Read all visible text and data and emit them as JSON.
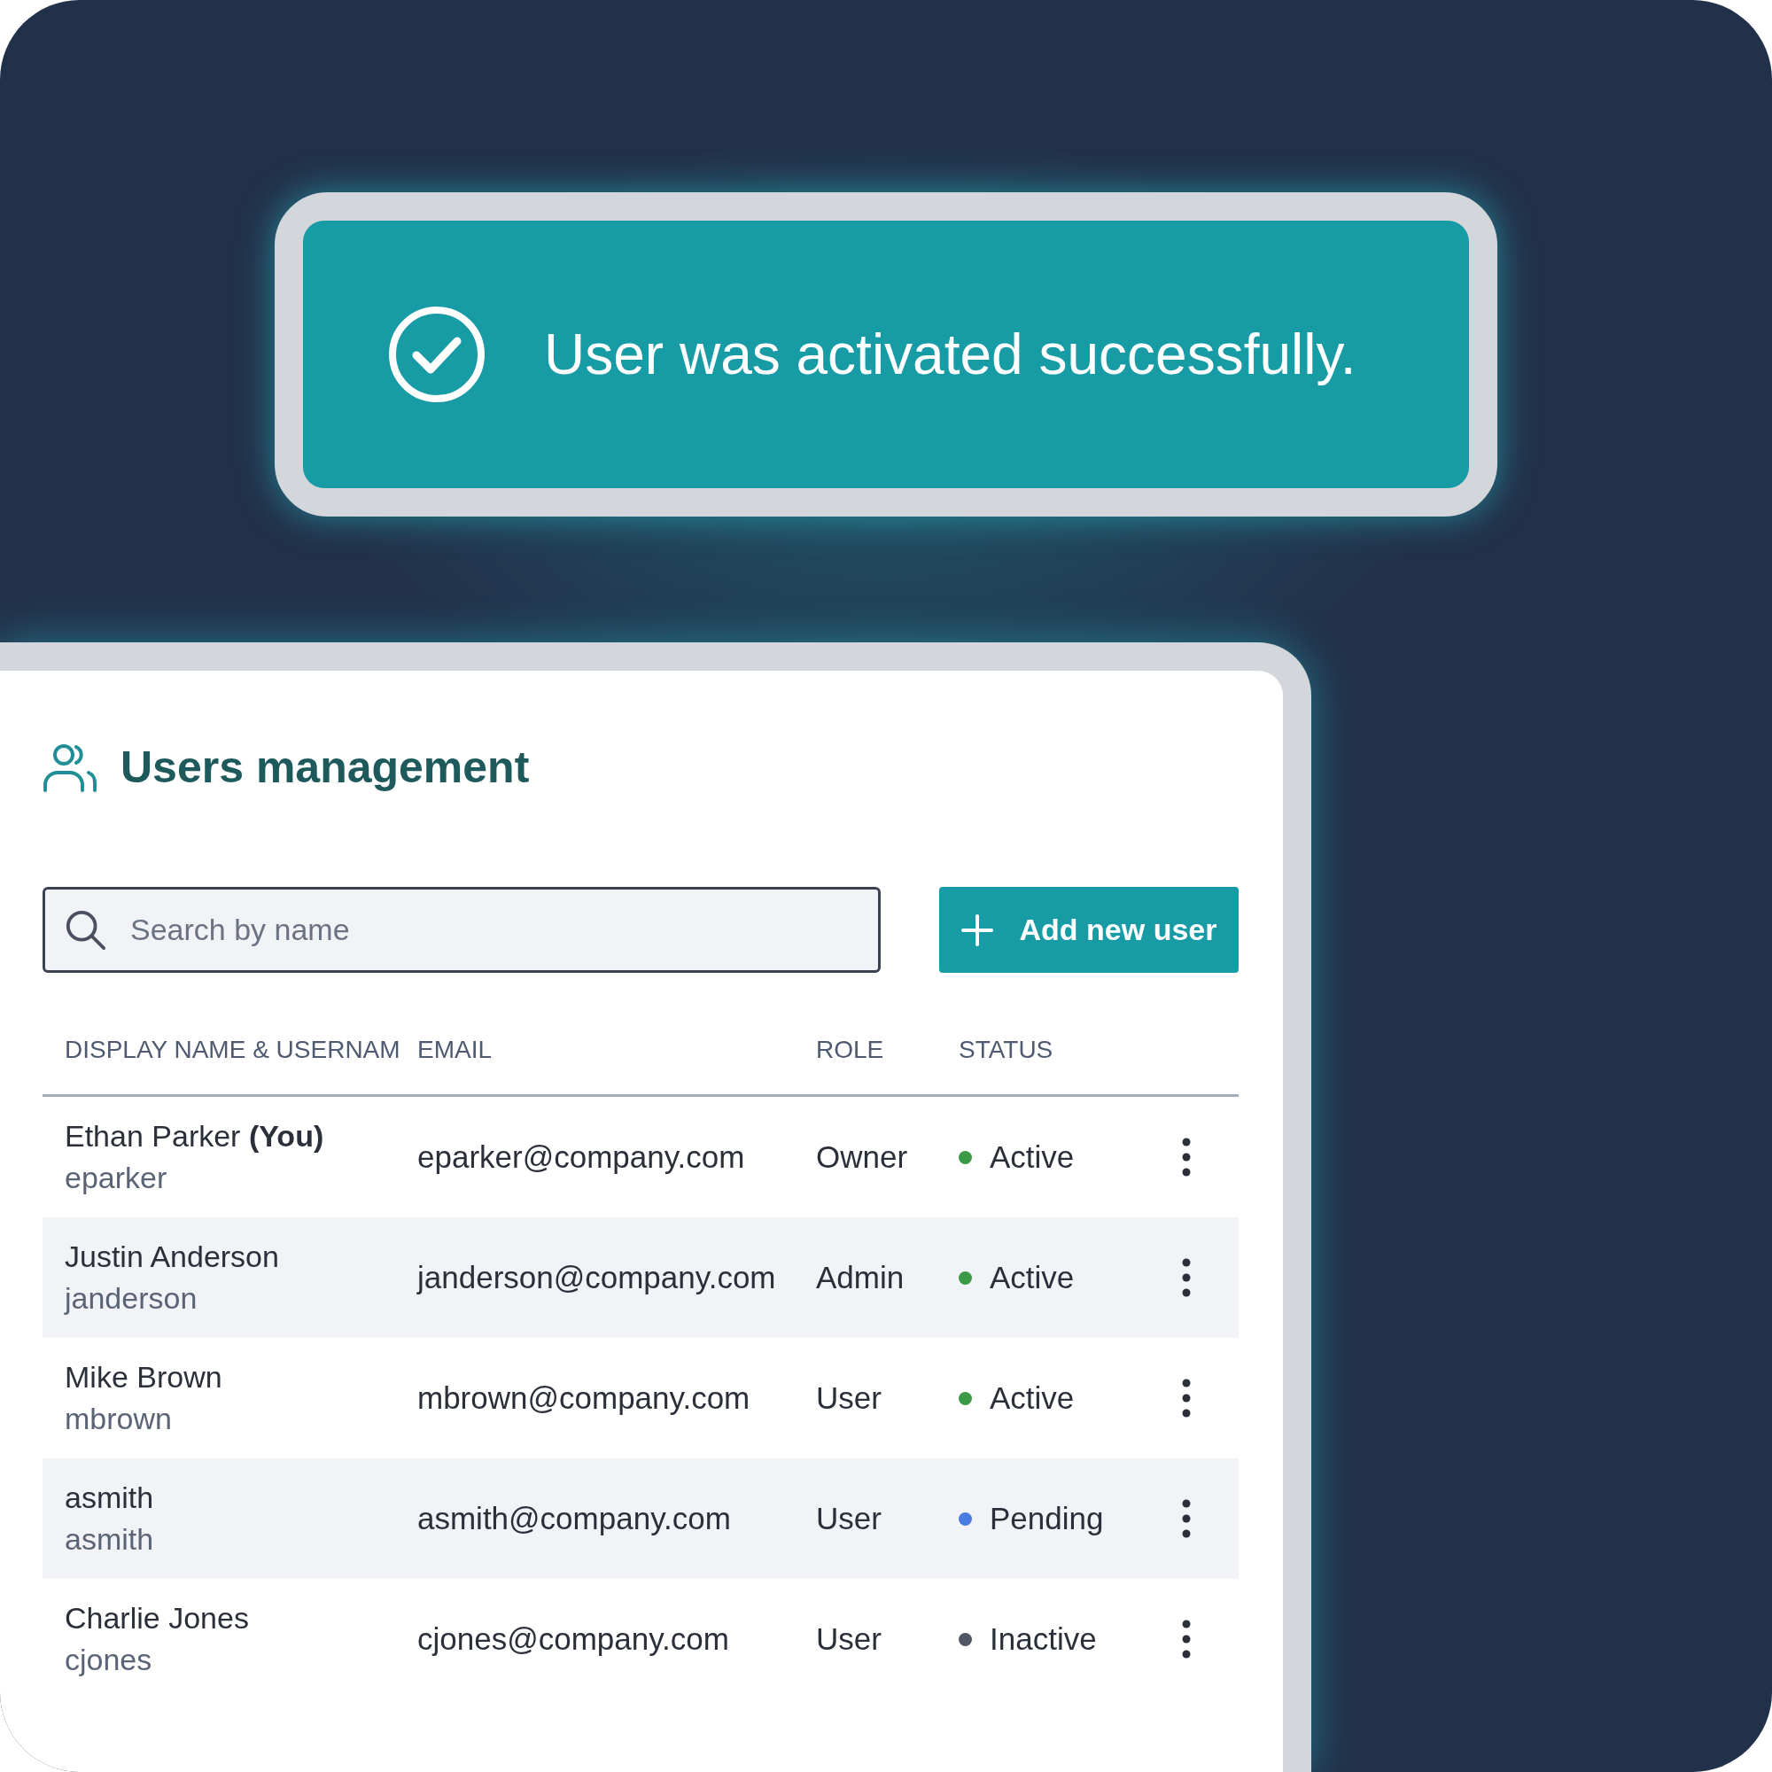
{
  "toast": {
    "message": "User was activated successfully."
  },
  "panel": {
    "title": "Users management",
    "search": {
      "placeholder": "Search by name"
    },
    "add_button": {
      "label": "Add new user"
    },
    "table": {
      "columns": [
        "DISPLAY NAME & USERNAM",
        "EMAIL",
        "ROLE",
        "STATUS"
      ],
      "rows": [
        {
          "name": "Ethan Parker **(You)**",
          "username": "eparker",
          "email": "eparker@company.com",
          "role": "Owner",
          "status": "Active",
          "color": "#3a9a45"
        },
        {
          "name": "Justin Anderson",
          "username": "janderson",
          "email": "janderson@company.com",
          "role": "Admin",
          "status": "Active",
          "color": "#3a9a45"
        },
        {
          "name": "Mike Brown",
          "username": "mbrown",
          "email": "mbrown@company.com",
          "role": "User",
          "status": "Active",
          "color": "#3a9a45"
        },
        {
          "name": "asmith",
          "username": "asmith",
          "email": "asmith@company.com",
          "role": "User",
          "status": "Pending",
          "color": "#4a7be0"
        },
        {
          "name": "Charlie Jones",
          "username": "cjones",
          "email": "cjones@company.com",
          "role": "User",
          "status": "Inactive",
          "color": "#4f5563"
        }
      ]
    }
  }
}
